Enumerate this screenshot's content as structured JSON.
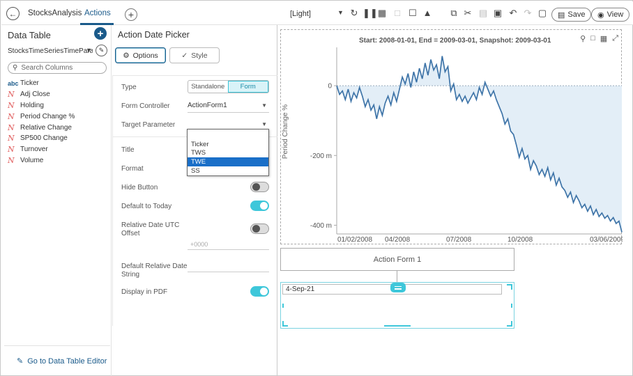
{
  "topbar": {
    "back_icon": "back-arrow-icon",
    "tabs": [
      {
        "label": "StocksAnalysis",
        "active": false
      },
      {
        "label": "Actions",
        "active": true
      }
    ],
    "theme": "[Light]",
    "save_label": "Save",
    "view_label": "View",
    "accent_color": "#1a5a8a"
  },
  "left_panel": {
    "title": "Data Table",
    "source": "StocksTimeSeriesTimeParameterized",
    "search_placeholder": "Search Columns",
    "columns": [
      {
        "name": "Ticker",
        "type": "text"
      },
      {
        "name": "Adj Close",
        "type": "numeric"
      },
      {
        "name": "Holding",
        "type": "numeric"
      },
      {
        "name": "Period Change %",
        "type": "numeric"
      },
      {
        "name": "Relative Change",
        "type": "numeric"
      },
      {
        "name": "SP500 Change",
        "type": "numeric"
      },
      {
        "name": "Turnover",
        "type": "numeric"
      },
      {
        "name": "Volume",
        "type": "numeric"
      }
    ],
    "footer_link": "Go to Data Table Editor"
  },
  "settings": {
    "title": "Action Date Picker",
    "tabs": {
      "options": "Options",
      "style": "Style"
    },
    "type_label": "Type",
    "type_options": [
      "Standalone",
      "Form"
    ],
    "type_selected": "Form",
    "form_controller_label": "Form Controller",
    "form_controller_value": "ActionForm1",
    "target_parameter_label": "Target Parameter",
    "target_parameter_options": [
      "Ticker",
      "TWS",
      "TWE",
      "SS"
    ],
    "target_parameter_highlighted": "TWE",
    "title_label": "Title",
    "format_label": "Format",
    "hide_button_label": "Hide Button",
    "hide_button_on": false,
    "default_today_label": "Default to Today",
    "default_today_on": true,
    "utc_offset_label_1": "Relative Date UTC",
    "utc_offset_label_2": "Offset",
    "utc_offset_on": false,
    "utc_offset_placeholder": "+0000",
    "default_relative_label_1": "Default Relative Date",
    "default_relative_label_2": "String",
    "display_pdf_label": "Display in PDF",
    "display_pdf_on": true
  },
  "canvas": {
    "chart_title": "Start: 2008-01-01, End = 2009-03-01, Snapshot: 2009-03-01",
    "form_label": "Action Form 1",
    "date_value": "4-Sep-21"
  },
  "chart_data": {
    "type": "area",
    "title": "Start: 2008-01-01, End = 2009-03-01, Snapshot: 2009-03-01",
    "xlabel": "",
    "ylabel": "Period Change %",
    "x_tick_labels": [
      "01/02/2008",
      "04/2008",
      "07/2008",
      "10/2008",
      "03/06/2009"
    ],
    "y_tick_labels": [
      "0",
      "-200 m",
      "-400 m"
    ],
    "y_ticks": [
      0,
      -200,
      -400
    ],
    "ylim": [
      -425,
      110
    ],
    "line_color": "#3e74a8",
    "fill_color": "#e3eef7",
    "grid": false,
    "x": [
      0,
      3,
      6,
      9,
      12,
      15,
      18,
      21,
      24,
      27,
      30,
      33,
      36,
      39,
      42,
      45,
      48,
      51,
      54,
      57,
      60,
      63,
      66,
      69,
      72,
      75,
      78,
      81,
      84,
      87,
      90,
      93,
      96,
      99,
      102,
      105,
      108,
      111,
      114,
      117,
      120,
      123,
      126,
      129,
      132,
      135,
      138,
      141,
      144,
      147,
      150,
      153,
      156,
      159,
      162,
      165,
      168,
      171,
      174,
      177,
      180,
      183,
      186,
      189,
      192,
      195,
      198,
      201,
      204,
      207,
      210,
      213,
      216,
      219,
      222,
      225,
      228,
      231,
      234,
      237,
      240,
      243,
      246,
      249,
      252,
      255,
      258,
      261,
      264,
      267,
      270,
      273,
      276,
      279,
      282,
      285,
      288,
      291,
      294,
      297,
      300
    ],
    "values": [
      0,
      -25,
      -15,
      -40,
      -10,
      -45,
      -20,
      -35,
      -5,
      -30,
      -60,
      -40,
      -70,
      -55,
      -95,
      -60,
      -85,
      -50,
      -30,
      -55,
      -20,
      -45,
      -10,
      25,
      5,
      35,
      -5,
      40,
      10,
      50,
      20,
      65,
      30,
      75,
      45,
      60,
      20,
      85,
      40,
      55,
      -15,
      5,
      -40,
      -25,
      -45,
      -30,
      -50,
      -35,
      -20,
      -40,
      -5,
      -25,
      10,
      -10,
      -30,
      -15,
      -40,
      -60,
      -80,
      -110,
      -95,
      -130,
      -140,
      -170,
      -205,
      -180,
      -210,
      -200,
      -240,
      -215,
      -230,
      -255,
      -240,
      -260,
      -235,
      -270,
      -250,
      -285,
      -265,
      -290,
      -300,
      -320,
      -305,
      -335,
      -315,
      -330,
      -350,
      -340,
      -360,
      -345,
      -370,
      -355,
      -375,
      -365,
      -380,
      -372,
      -388,
      -378,
      -395,
      -388,
      -420
    ]
  }
}
